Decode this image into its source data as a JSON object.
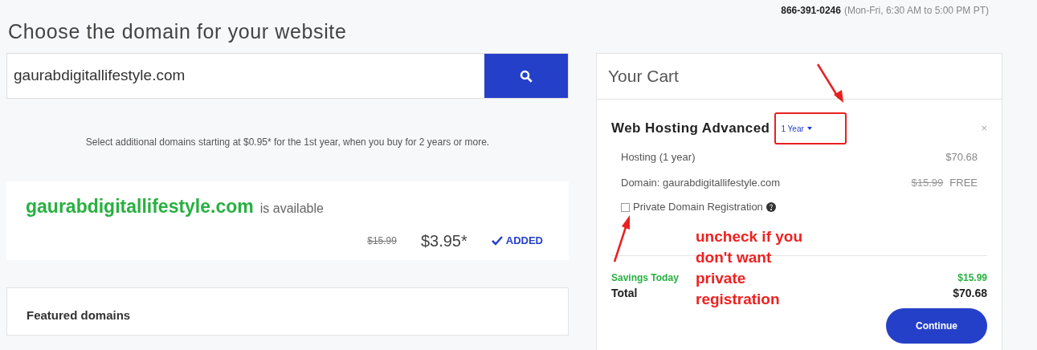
{
  "header": {
    "phone": "866-391-0246",
    "hours": "(Mon-Fri, 6:30 AM to 5:00 PM PT)"
  },
  "title": "Choose the domain for your website",
  "search": {
    "value": "gaurabdigitallifestyle.com"
  },
  "promo": "Select additional domains starting at $0.95* for the 1st year, when you buy for 2 years or more.",
  "result": {
    "domain": "gaurabdigitallifestyle.com",
    "status": "is available",
    "old_price": "$15.99",
    "price": "$3.95*",
    "action": "ADDED",
    "added": true
  },
  "featured": {
    "title": "Featured domains"
  },
  "cart": {
    "title": "Your Cart",
    "item": "Web Hosting Advanced",
    "term": "1 Year",
    "close": "×",
    "lines": [
      {
        "label": "Hosting (1 year)",
        "price": "$70.68"
      },
      {
        "label": "Domain: gaurabdigitallifestyle.com",
        "old_price": "$15.99",
        "price": "FREE"
      }
    ],
    "privacy": {
      "label": "Private Domain Registration",
      "checked": false
    },
    "savings": {
      "label": "Savings Today",
      "value": "$15.99"
    },
    "total": {
      "label": "Total",
      "value": "$70.68"
    },
    "button": "Continue"
  },
  "annotation": {
    "text": "uncheck if you don't want private registration"
  }
}
